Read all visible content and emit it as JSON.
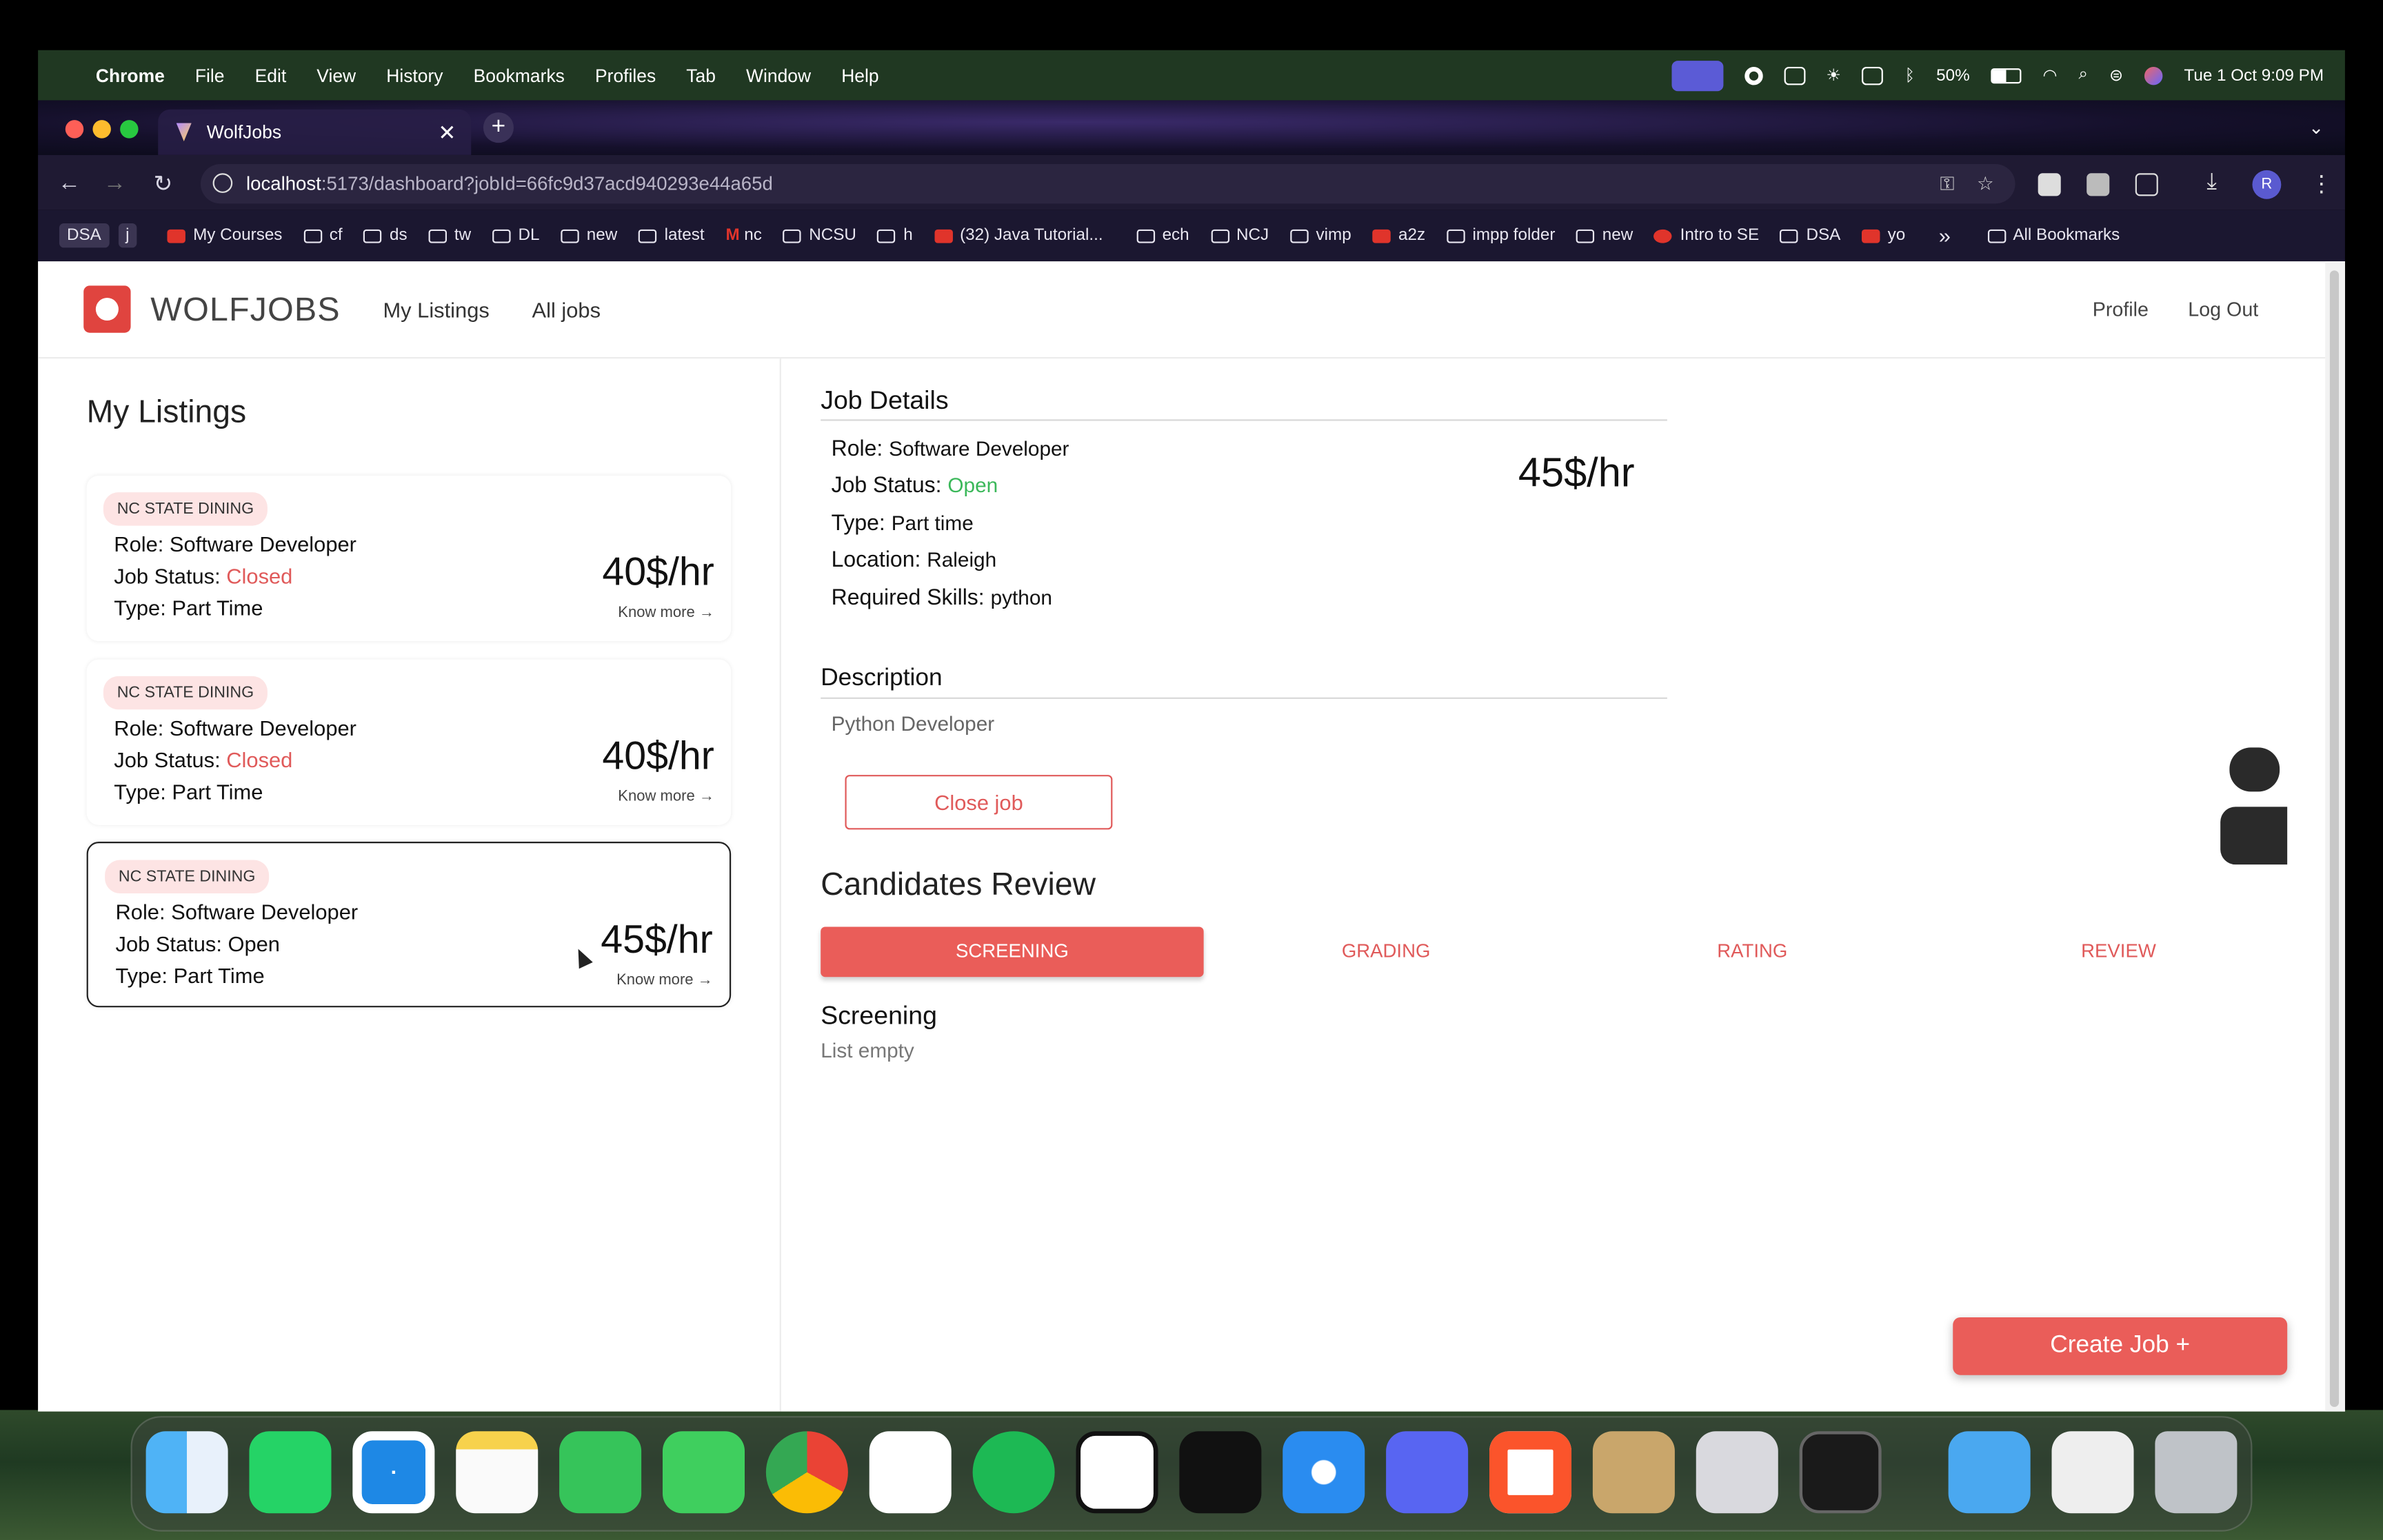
{
  "menubar": {
    "app": "Chrome",
    "items": [
      "File",
      "Edit",
      "View",
      "History",
      "Bookmarks",
      "Profiles",
      "Tab",
      "Window",
      "Help"
    ],
    "battery": "50%",
    "datetime": "Tue 1 Oct  9:09 PM"
  },
  "browser": {
    "tab_title": "WolfJobs",
    "url_host": "localhost",
    "url_path": ":5173/dashboard?jobId=66fc9d37acd940293e44a65d",
    "bookmarks": [
      "DSA",
      "j",
      "My Courses",
      "cf",
      "ds",
      "tw",
      "DL",
      "new",
      "latest",
      "nc",
      "NCSU",
      "h",
      "(32) Java Tutorial...",
      "ech",
      "NCJ",
      "vimp",
      "a2z",
      "impp folder",
      "new",
      "Intro to SE",
      "DSA",
      "yo"
    ],
    "all_bookmarks": "All Bookmarks",
    "overflow": "»"
  },
  "header": {
    "brand": "WOLFJOBS",
    "nav_my_listings": "My Listings",
    "nav_all_jobs": "All jobs",
    "profile": "Profile",
    "logout": "Log Out"
  },
  "listings": {
    "title": "My Listings",
    "cards": [
      {
        "company": "NC STATE DINING",
        "role_label": "Role:",
        "role": "Software Developer",
        "status_label": "Job Status:",
        "status": "Closed",
        "type_label": "Type:",
        "type": "Part Time",
        "pay": "40$/hr",
        "know_more": "Know more →"
      },
      {
        "company": "NC STATE DINING",
        "role_label": "Role:",
        "role": "Software Developer",
        "status_label": "Job Status:",
        "status": "Closed",
        "type_label": "Type:",
        "type": "Part Time",
        "pay": "40$/hr",
        "know_more": "Know more →"
      },
      {
        "company": "NC STATE DINING",
        "role_label": "Role:",
        "role": "Software Developer",
        "status_label": "Job Status:",
        "status": "Open",
        "type_label": "Type:",
        "type": "Part Time",
        "pay": "45$/hr",
        "know_more": "Know more →"
      }
    ]
  },
  "job_details": {
    "title": "Job Details",
    "role_label": "Role:",
    "role": "Software Developer",
    "status_label": "Job Status:",
    "status": "Open",
    "type_label": "Type:",
    "type": "Part time",
    "location_label": "Location:",
    "location": "Raleigh",
    "skills_label": "Required Skills:",
    "skills": "python",
    "pay": "45$/hr",
    "description_title": "Description",
    "description": "Python Developer",
    "close_job": "Close job"
  },
  "candidates": {
    "title": "Candidates Review",
    "tabs": [
      "SCREENING",
      "GRADING",
      "RATING",
      "REVIEW"
    ],
    "section_title": "Screening",
    "empty": "List empty"
  },
  "create_job": "Create Job +",
  "colors": {
    "accent": "#ea5d59",
    "open": "#3bb85a",
    "closed": "#e05a5a"
  }
}
